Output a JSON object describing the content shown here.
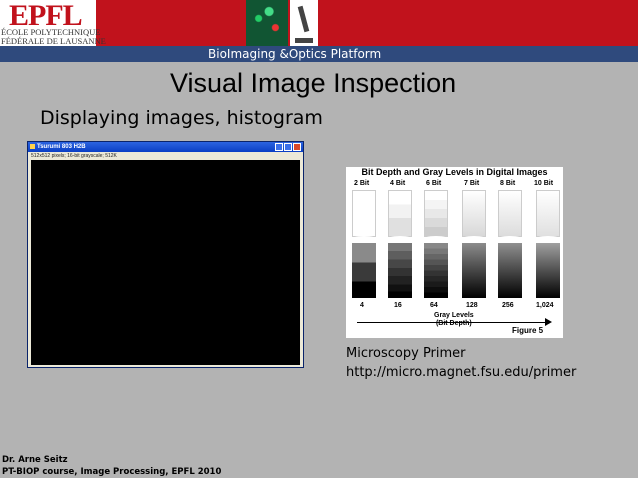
{
  "header": {
    "logo": {
      "mark": "EPFL",
      "line1": "ÉCOLE POLYTECHNIQUE",
      "line2": "FÉDÉRALE DE LAUSANNE"
    },
    "nav_title": "BioImaging &Optics Platform"
  },
  "slide": {
    "title": "Visual Image Inspection",
    "subtitle": "Displaying images, histogram"
  },
  "image_window": {
    "title": "Tsurumi 803 H2B",
    "info": "512x512 pixels; 16-bit grayscale; 512K",
    "icons": [
      "minimize-icon",
      "maximize-icon",
      "close-icon"
    ]
  },
  "figure": {
    "title": "Bit Depth and Gray Levels in Digital Images",
    "bit_depths": [
      "2 Bit",
      "4 Bit",
      "6 Bit",
      "7 Bit",
      "8 Bit",
      "10 Bit"
    ],
    "gray_levels": [
      "4",
      "16",
      "64",
      "128",
      "256",
      "1,024"
    ],
    "axis_label_1": "Gray Levels",
    "axis_label_2": "(Bit Depth)",
    "caption": "Figure 5"
  },
  "credit": {
    "line1": "Microscopy Primer",
    "line2": "http://micro.magnet.fsu.edu/primer"
  },
  "footer": {
    "author": "Dr. Arne Seitz",
    "course": "PT-BIOP course, Image Processing, EPFL 2010"
  }
}
